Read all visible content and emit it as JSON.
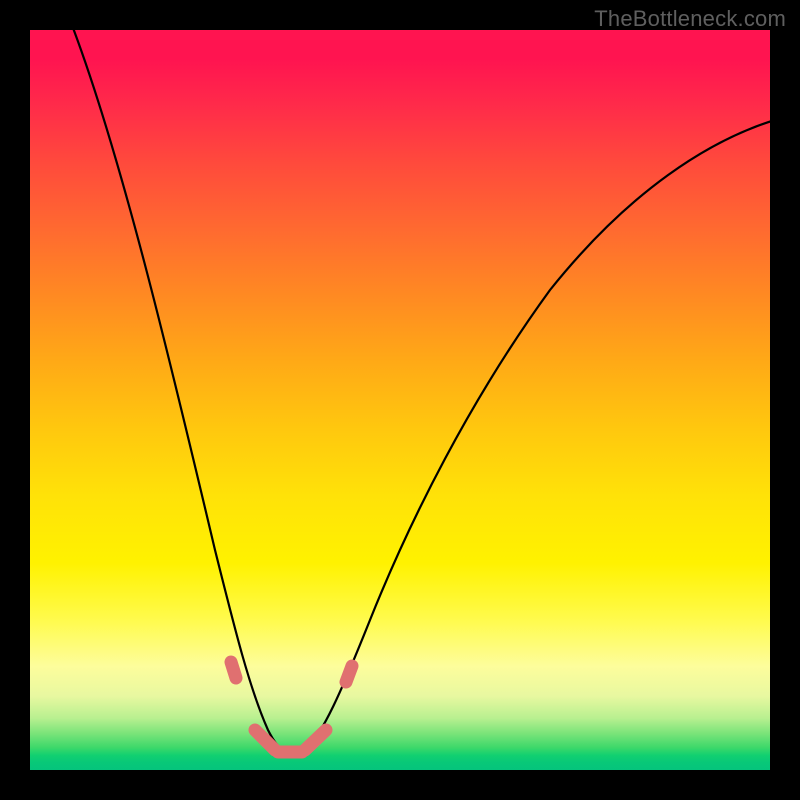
{
  "watermark": "TheBottleneck.com",
  "chart_data": {
    "type": "line",
    "title": "",
    "xlabel": "",
    "ylabel": "",
    "xlim": [
      0,
      100
    ],
    "ylim": [
      0,
      100
    ],
    "notes": "Smooth V-shaped curve over a vertical rainbow gradient (red top → green bottom). Curve minimum is near x≈33, y≈2. Coral bead markers sit along the curve near the trough (roughly x 26–42, y 2–13). No axis ticks or labels are visible.",
    "series": [
      {
        "name": "bottleneck-curve",
        "x": [
          4,
          8,
          12,
          16,
          20,
          24,
          28,
          30,
          32,
          33,
          34,
          36,
          38,
          42,
          48,
          56,
          66,
          78,
          90,
          100
        ],
        "values": [
          100,
          86,
          71,
          56,
          41,
          27,
          14,
          8,
          4,
          2,
          3,
          5,
          9,
          17,
          29,
          43,
          57,
          70,
          79,
          85
        ]
      }
    ],
    "markers": [
      {
        "x": 25.5,
        "y": 13
      },
      {
        "x": 26.5,
        "y": 11
      },
      {
        "x": 29,
        "y": 4.5
      },
      {
        "x": 31,
        "y": 3
      },
      {
        "x": 33,
        "y": 2.5
      },
      {
        "x": 35,
        "y": 3
      },
      {
        "x": 37,
        "y": 4.5
      },
      {
        "x": 40.5,
        "y": 10
      },
      {
        "x": 41.5,
        "y": 12.5
      }
    ],
    "gradient_stops": [
      {
        "pos": 0,
        "color": "#ff1450"
      },
      {
        "pos": 50,
        "color": "#ffc80e"
      },
      {
        "pos": 80,
        "color": "#fffb50"
      },
      {
        "pos": 100,
        "color": "#06c47c"
      }
    ]
  }
}
